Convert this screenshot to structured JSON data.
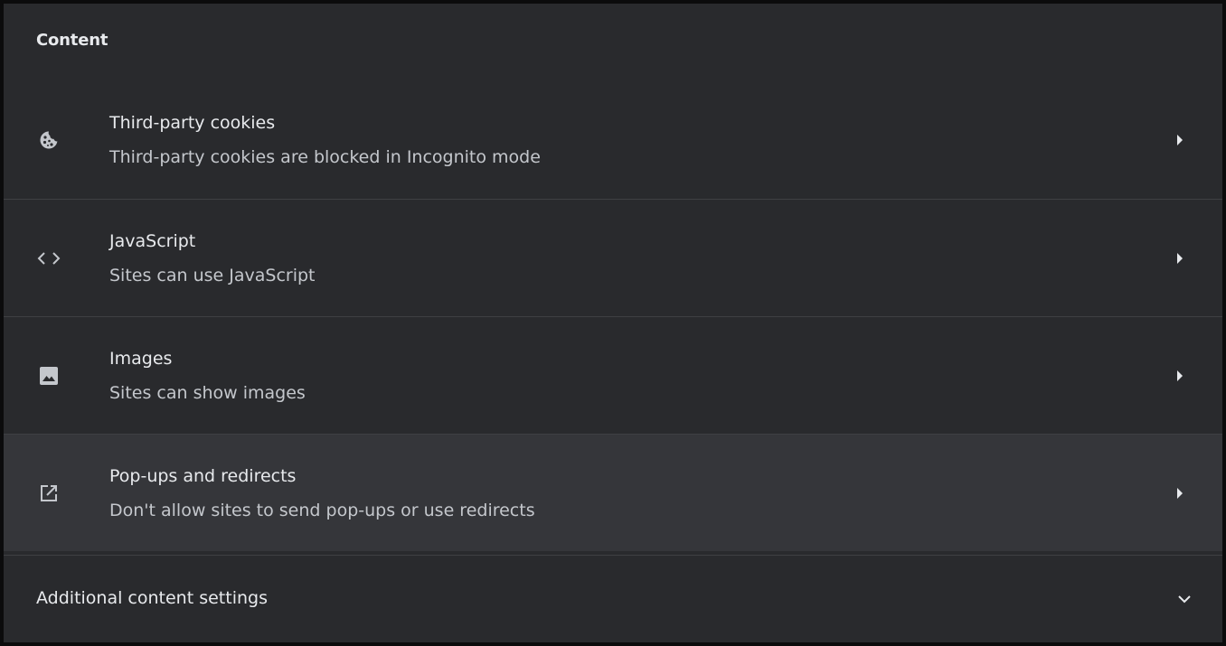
{
  "section": {
    "title": "Content"
  },
  "items": [
    {
      "title": "Third-party cookies",
      "subtitle": "Third-party cookies are blocked in Incognito mode",
      "icon": "cookie-icon"
    },
    {
      "title": "JavaScript",
      "subtitle": "Sites can use JavaScript",
      "icon": "code-icon"
    },
    {
      "title": "Images",
      "subtitle": "Sites can show images",
      "icon": "image-icon"
    },
    {
      "title": "Pop-ups and redirects",
      "subtitle": "Don't allow sites to send pop-ups or use redirects",
      "icon": "open-in-new-icon"
    }
  ],
  "additional": {
    "label": "Additional content settings",
    "icon": "chevron-down-icon"
  },
  "colors": {
    "background": "#292a2d",
    "hover_row": "#35363a",
    "separator": "#3f4043",
    "text_primary": "#e8eaed",
    "text_secondary": "#c4c7cc",
    "icon": "#c4c7cc"
  }
}
